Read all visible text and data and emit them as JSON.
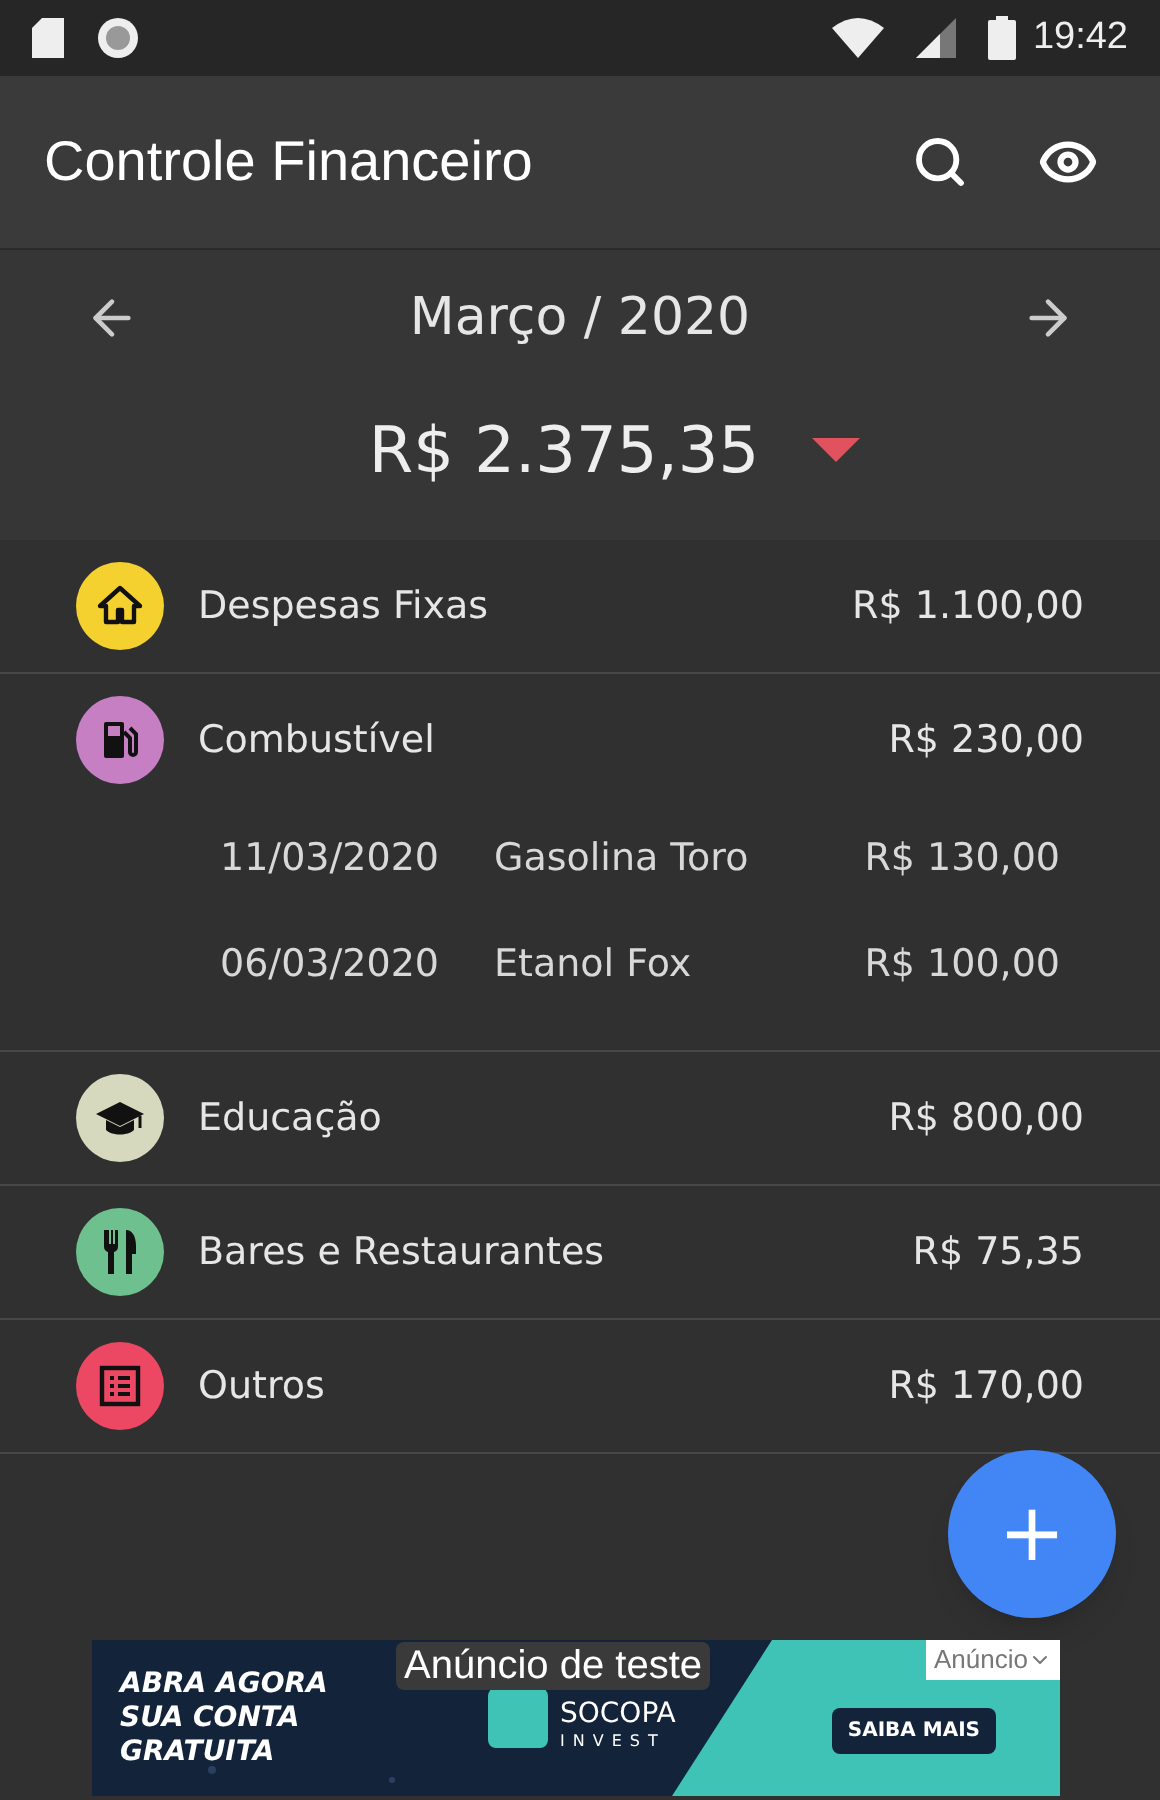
{
  "status_bar": {
    "time": "19:42"
  },
  "app_bar": {
    "title": "Controle Financeiro"
  },
  "period": {
    "month": "Março / 2020",
    "total": "R$ 2.375,35"
  },
  "categories": [
    {
      "name": "Despesas Fixas",
      "amount": "R$ 1.100,00",
      "color": "#f5d130"
    },
    {
      "name": "Combustível",
      "amount": "R$ 230,00",
      "color": "#c77fc4",
      "entries": [
        {
          "date": "11/03/2020",
          "description": "Gasolina Toro",
          "amount": "R$ 130,00"
        },
        {
          "date": "06/03/2020",
          "description": "Etanol Fox",
          "amount": "R$ 100,00"
        }
      ]
    },
    {
      "name": "Educação",
      "amount": "R$ 800,00",
      "color": "#d6d9bd"
    },
    {
      "name": "Bares e Restaurantes",
      "amount": "R$ 75,35",
      "color": "#6fc08f"
    },
    {
      "name": "Outros",
      "amount": "R$ 170,00",
      "color": "#ec4763"
    }
  ],
  "fab": {
    "label": "+"
  },
  "ad": {
    "overlay": "Anúncio de teste",
    "headline": "ABRA AGORA SUA CONTA GRATUITA",
    "brand": "SOCOPA",
    "brand_sub": "INVEST",
    "cta": "SAIBA MAIS",
    "badge": "Anúncio"
  }
}
